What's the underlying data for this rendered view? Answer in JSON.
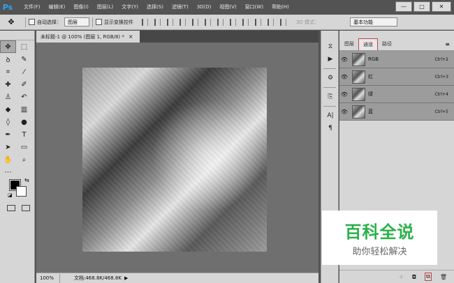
{
  "menubar": {
    "logo": "Ps",
    "items": [
      "文件(F)",
      "编辑(E)",
      "图像(I)",
      "图层(L)",
      "文字(Y)",
      "选择(S)",
      "滤镜(T)",
      "3D(D)",
      "视图(V)",
      "窗口(W)",
      "帮助(H)"
    ],
    "minimize": "—",
    "restore": "□",
    "close": "✕"
  },
  "options": {
    "tool_glyph": "✥",
    "auto_select_label": "自动选择：",
    "auto_select_value": "图层",
    "transform_label": "显示变换控件",
    "mode_3d_label": "3D 模式：",
    "workspace_value": "基本功能"
  },
  "document": {
    "tab_title": "未标题-1 @ 100% (图层 1, RGB/8) *",
    "tab_close": "×",
    "zoom": "100%",
    "doc_info": "文档:468.8K/468.8K",
    "status_arrow": "▶"
  },
  "panel": {
    "tabs": [
      "图层",
      "通道",
      "路径"
    ],
    "active_tab": 1,
    "menu_icon": "≡",
    "channels": [
      {
        "name": "RGB",
        "shortcut": "Ctrl+2"
      },
      {
        "name": "红",
        "shortcut": "Ctrl+3"
      },
      {
        "name": "绿",
        "shortcut": "Ctrl+4"
      },
      {
        "name": "蓝",
        "shortcut": "Ctrl+5"
      }
    ],
    "bottom_icons": [
      "⁘",
      "◘",
      "⧉",
      "🗑"
    ]
  },
  "watermark": {
    "title": "百科全说",
    "subtitle": "助你轻松解决"
  },
  "colors": {
    "foreground": "#000000",
    "background": "#ffffff",
    "accent_red": "#c94040",
    "brand_green": "#2ab14b"
  }
}
